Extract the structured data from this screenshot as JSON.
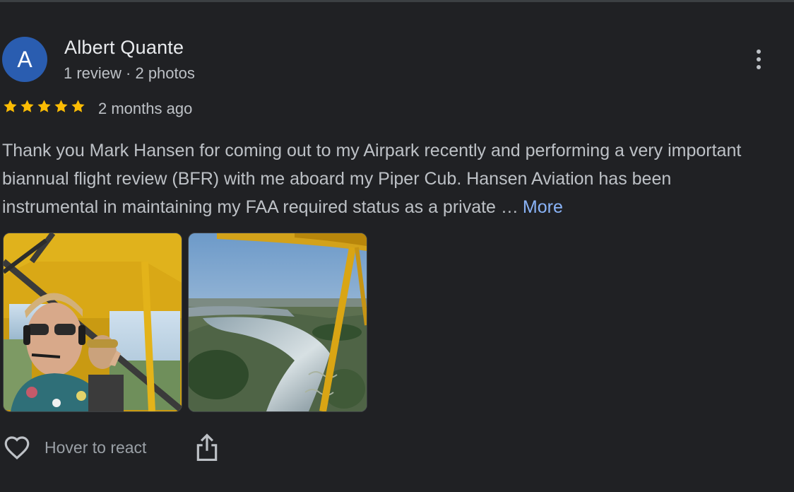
{
  "reviewer": {
    "initial": "A",
    "name": "Albert Quante",
    "meta": "1 review · 2 photos",
    "avatar_color": "#2a5db0"
  },
  "menu": {
    "icon": "more-vert-icon"
  },
  "rating": {
    "stars": 5,
    "max": 5,
    "star_color": "#fbbc04",
    "time_ago": "2 months ago"
  },
  "review": {
    "text": "Thank you Mark Hansen for coming out to my Airpark recently and performing a very important biannual flight review (BFR) with me aboard my Piper Cub. Hansen Aviation has been instrumental in maintaining my FAA required status as a private …",
    "more_label": "More",
    "link_color": "#8ab4f8"
  },
  "photos": [
    {
      "subject": "cockpit-selfie-photo"
    },
    {
      "subject": "aerial-river-photo"
    }
  ],
  "actions": {
    "react_label": "Hover to react",
    "react_icon": "heart-outline-icon",
    "share_icon": "share-icon"
  }
}
